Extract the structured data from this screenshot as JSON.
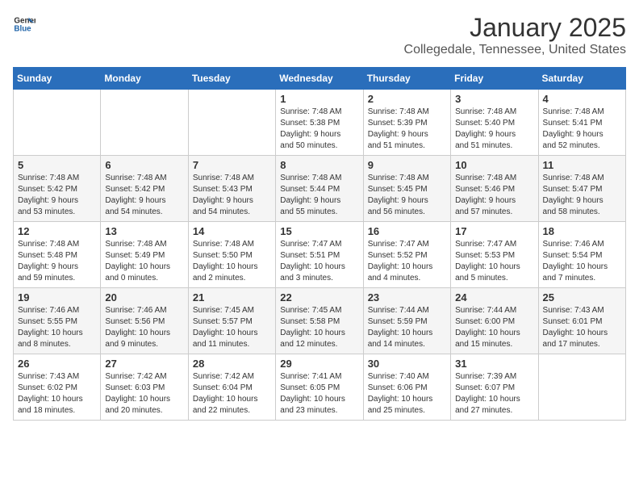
{
  "header": {
    "logo_general": "General",
    "logo_blue": "Blue",
    "month": "January 2025",
    "location": "Collegedale, Tennessee, United States"
  },
  "days_of_week": [
    "Sunday",
    "Monday",
    "Tuesday",
    "Wednesday",
    "Thursday",
    "Friday",
    "Saturday"
  ],
  "weeks": [
    [
      {
        "day": "",
        "info": ""
      },
      {
        "day": "",
        "info": ""
      },
      {
        "day": "",
        "info": ""
      },
      {
        "day": "1",
        "info": "Sunrise: 7:48 AM\nSunset: 5:38 PM\nDaylight: 9 hours\nand 50 minutes."
      },
      {
        "day": "2",
        "info": "Sunrise: 7:48 AM\nSunset: 5:39 PM\nDaylight: 9 hours\nand 51 minutes."
      },
      {
        "day": "3",
        "info": "Sunrise: 7:48 AM\nSunset: 5:40 PM\nDaylight: 9 hours\nand 51 minutes."
      },
      {
        "day": "4",
        "info": "Sunrise: 7:48 AM\nSunset: 5:41 PM\nDaylight: 9 hours\nand 52 minutes."
      }
    ],
    [
      {
        "day": "5",
        "info": "Sunrise: 7:48 AM\nSunset: 5:42 PM\nDaylight: 9 hours\nand 53 minutes."
      },
      {
        "day": "6",
        "info": "Sunrise: 7:48 AM\nSunset: 5:42 PM\nDaylight: 9 hours\nand 54 minutes."
      },
      {
        "day": "7",
        "info": "Sunrise: 7:48 AM\nSunset: 5:43 PM\nDaylight: 9 hours\nand 54 minutes."
      },
      {
        "day": "8",
        "info": "Sunrise: 7:48 AM\nSunset: 5:44 PM\nDaylight: 9 hours\nand 55 minutes."
      },
      {
        "day": "9",
        "info": "Sunrise: 7:48 AM\nSunset: 5:45 PM\nDaylight: 9 hours\nand 56 minutes."
      },
      {
        "day": "10",
        "info": "Sunrise: 7:48 AM\nSunset: 5:46 PM\nDaylight: 9 hours\nand 57 minutes."
      },
      {
        "day": "11",
        "info": "Sunrise: 7:48 AM\nSunset: 5:47 PM\nDaylight: 9 hours\nand 58 minutes."
      }
    ],
    [
      {
        "day": "12",
        "info": "Sunrise: 7:48 AM\nSunset: 5:48 PM\nDaylight: 9 hours\nand 59 minutes."
      },
      {
        "day": "13",
        "info": "Sunrise: 7:48 AM\nSunset: 5:49 PM\nDaylight: 10 hours\nand 0 minutes."
      },
      {
        "day": "14",
        "info": "Sunrise: 7:48 AM\nSunset: 5:50 PM\nDaylight: 10 hours\nand 2 minutes."
      },
      {
        "day": "15",
        "info": "Sunrise: 7:47 AM\nSunset: 5:51 PM\nDaylight: 10 hours\nand 3 minutes."
      },
      {
        "day": "16",
        "info": "Sunrise: 7:47 AM\nSunset: 5:52 PM\nDaylight: 10 hours\nand 4 minutes."
      },
      {
        "day": "17",
        "info": "Sunrise: 7:47 AM\nSunset: 5:53 PM\nDaylight: 10 hours\nand 5 minutes."
      },
      {
        "day": "18",
        "info": "Sunrise: 7:46 AM\nSunset: 5:54 PM\nDaylight: 10 hours\nand 7 minutes."
      }
    ],
    [
      {
        "day": "19",
        "info": "Sunrise: 7:46 AM\nSunset: 5:55 PM\nDaylight: 10 hours\nand 8 minutes."
      },
      {
        "day": "20",
        "info": "Sunrise: 7:46 AM\nSunset: 5:56 PM\nDaylight: 10 hours\nand 9 minutes."
      },
      {
        "day": "21",
        "info": "Sunrise: 7:45 AM\nSunset: 5:57 PM\nDaylight: 10 hours\nand 11 minutes."
      },
      {
        "day": "22",
        "info": "Sunrise: 7:45 AM\nSunset: 5:58 PM\nDaylight: 10 hours\nand 12 minutes."
      },
      {
        "day": "23",
        "info": "Sunrise: 7:44 AM\nSunset: 5:59 PM\nDaylight: 10 hours\nand 14 minutes."
      },
      {
        "day": "24",
        "info": "Sunrise: 7:44 AM\nSunset: 6:00 PM\nDaylight: 10 hours\nand 15 minutes."
      },
      {
        "day": "25",
        "info": "Sunrise: 7:43 AM\nSunset: 6:01 PM\nDaylight: 10 hours\nand 17 minutes."
      }
    ],
    [
      {
        "day": "26",
        "info": "Sunrise: 7:43 AM\nSunset: 6:02 PM\nDaylight: 10 hours\nand 18 minutes."
      },
      {
        "day": "27",
        "info": "Sunrise: 7:42 AM\nSunset: 6:03 PM\nDaylight: 10 hours\nand 20 minutes."
      },
      {
        "day": "28",
        "info": "Sunrise: 7:42 AM\nSunset: 6:04 PM\nDaylight: 10 hours\nand 22 minutes."
      },
      {
        "day": "29",
        "info": "Sunrise: 7:41 AM\nSunset: 6:05 PM\nDaylight: 10 hours\nand 23 minutes."
      },
      {
        "day": "30",
        "info": "Sunrise: 7:40 AM\nSunset: 6:06 PM\nDaylight: 10 hours\nand 25 minutes."
      },
      {
        "day": "31",
        "info": "Sunrise: 7:39 AM\nSunset: 6:07 PM\nDaylight: 10 hours\nand 27 minutes."
      },
      {
        "day": "",
        "info": ""
      }
    ]
  ]
}
